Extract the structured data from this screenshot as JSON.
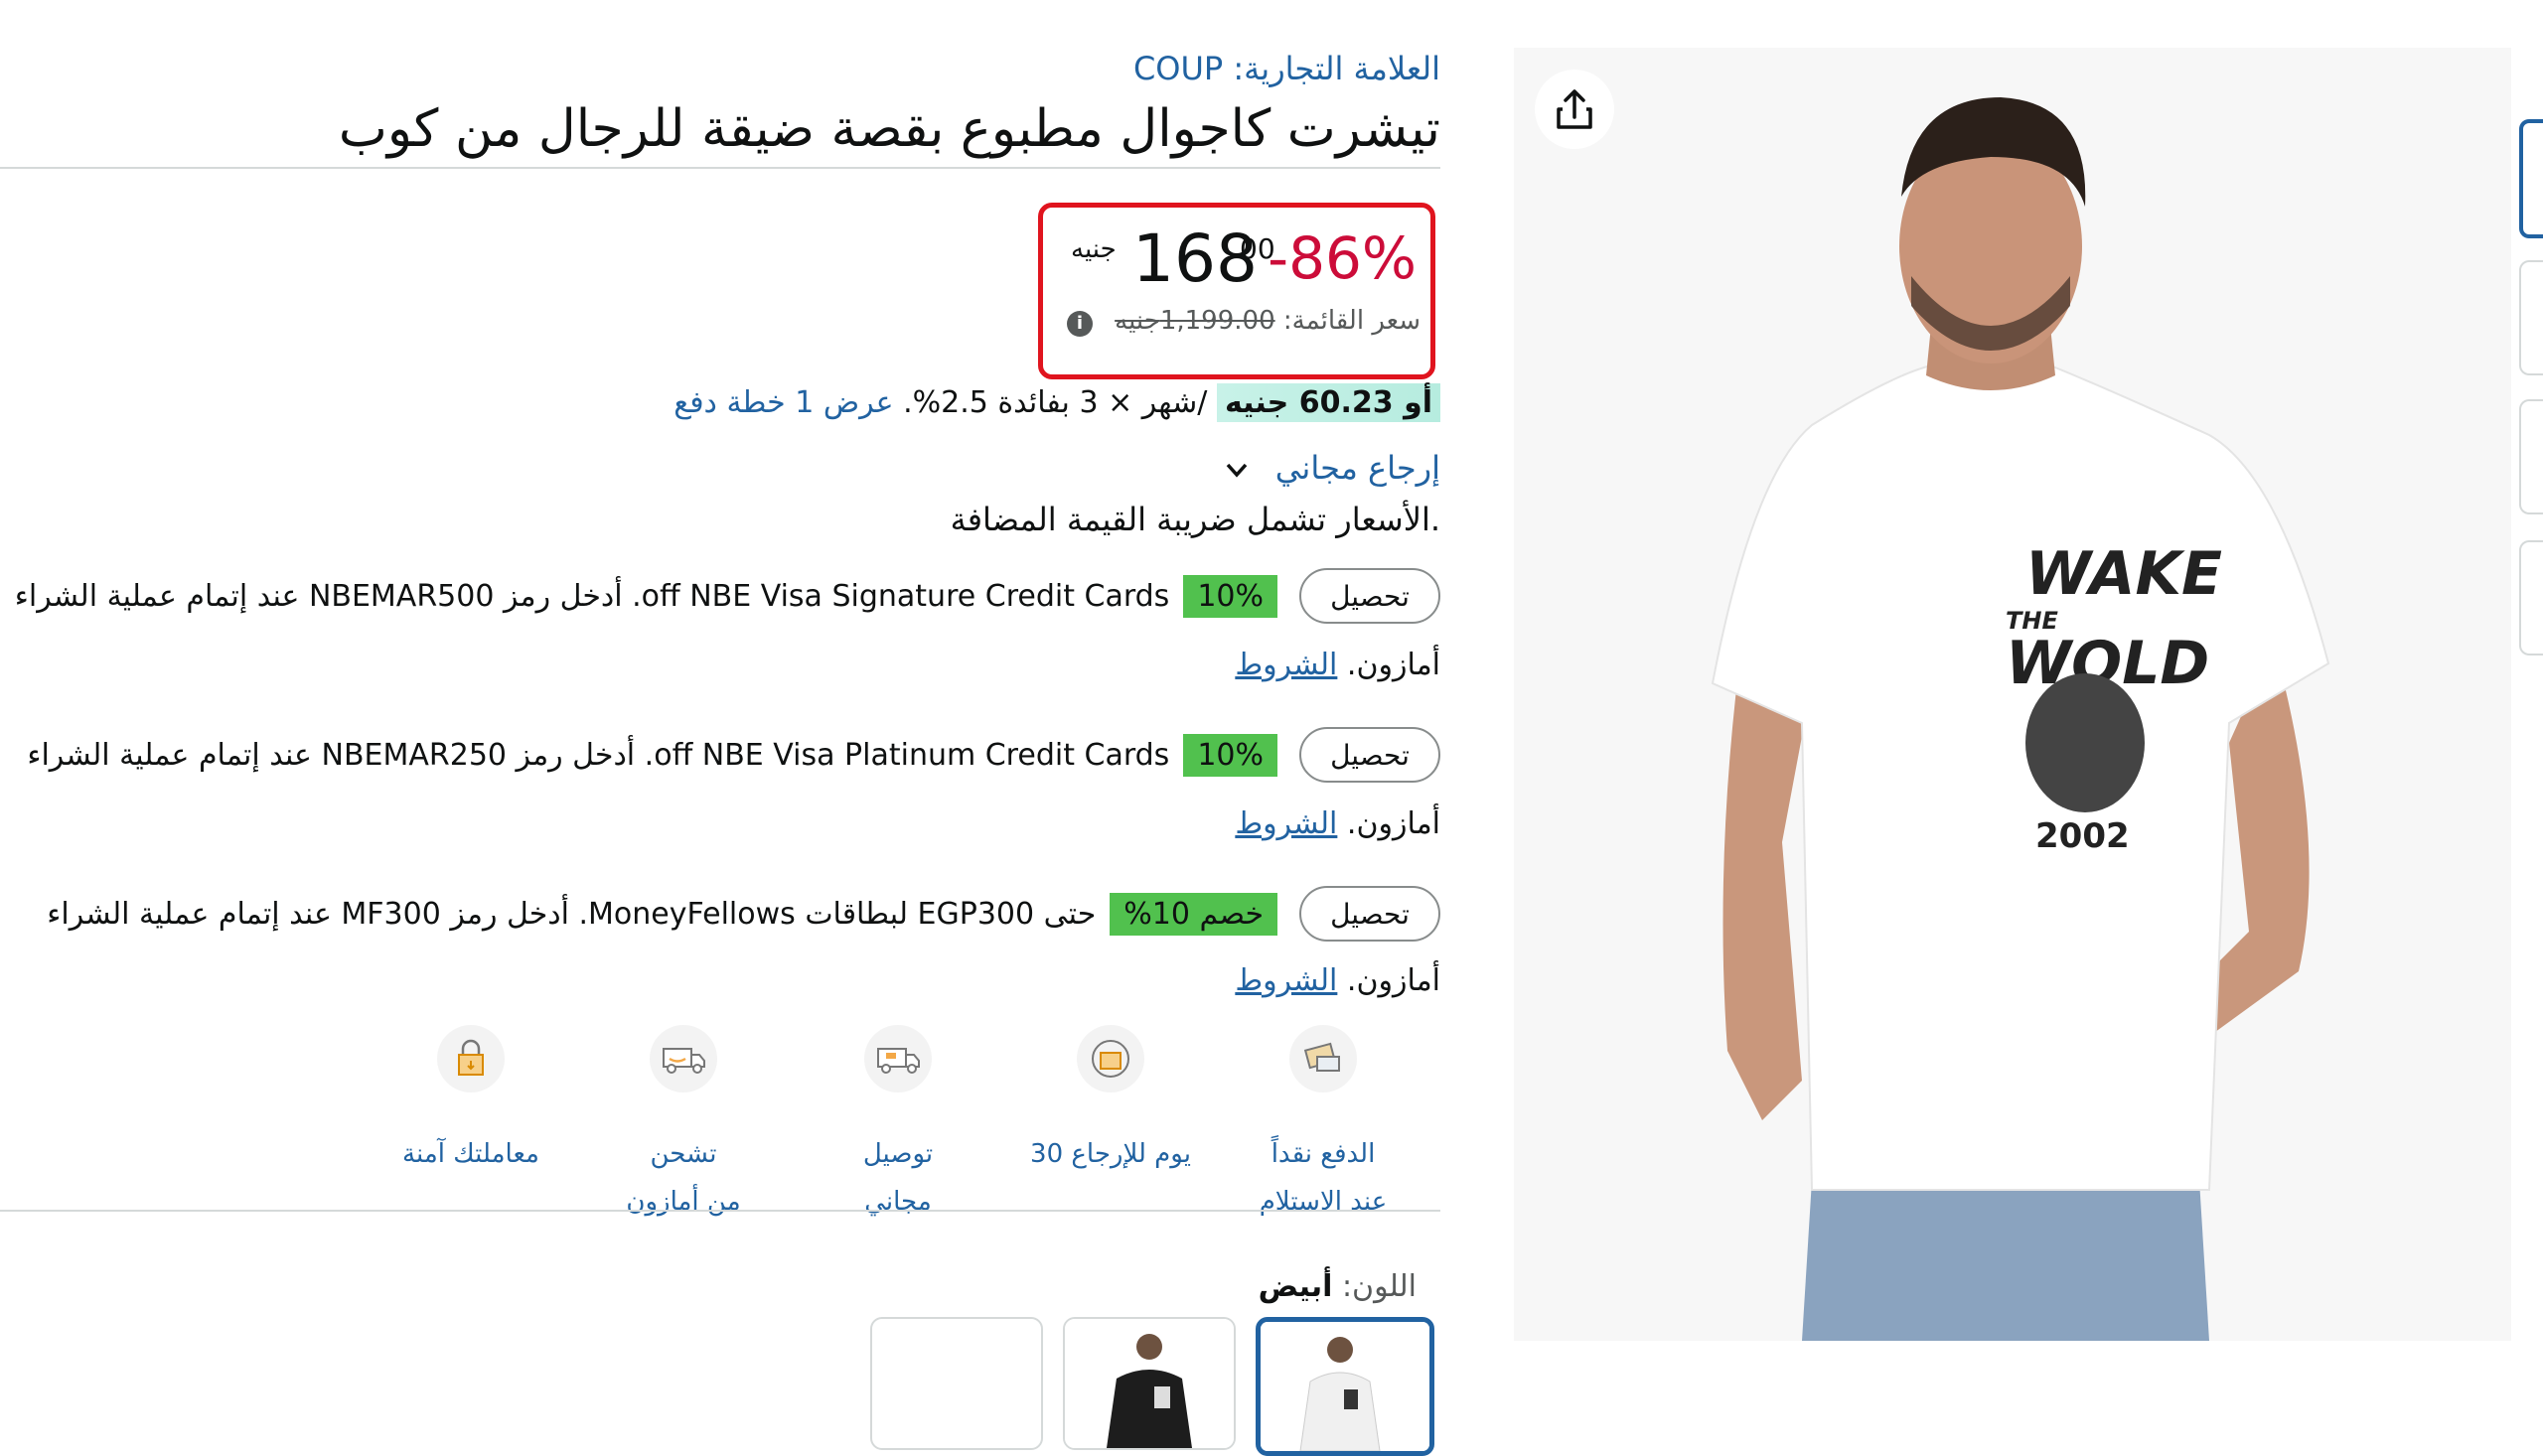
{
  "brand": {
    "label": "العلامة التجارية: COUP"
  },
  "title": "تيشرت كاجوال مطبوع بقصة ضيقة للرجال من كوب",
  "price": {
    "discount": "-86%",
    "currency": "جنيه",
    "whole": "168",
    "fraction": "00",
    "list_label": "سعر القائمة:",
    "list_value": "1,199.00جنيه"
  },
  "installment": {
    "prefix": "أو",
    "amount": "60.23 جنيه",
    "suffix": "/شهر × 3 بفائدة 2.5%.",
    "link": "عرض 1 خطة دفع"
  },
  "free_return": "إرجاع مجاني",
  "vat_note": ".الأسعار تشمل ضريبة القيمة المضافة",
  "offers": [
    {
      "button": "تحصيل",
      "badge": "10%",
      "text": "off NBE Visa Signature Credit Cards. أدخل رمز NBEMAR500 عند إتمام عملية الشراء",
      "terms_prefix": "أمازون.",
      "terms_link": "الشروط"
    },
    {
      "button": "تحصيل",
      "badge": "10%",
      "text": "off NBE Visa Platinum Credit Cards. أدخل رمز NBEMAR250 عند إتمام عملية الشراء",
      "terms_prefix": "أمازون.",
      "terms_link": "الشروط"
    },
    {
      "button": "تحصيل",
      "badge": "خصم 10%",
      "text": "حتى EGP300 لبطاقات MoneyFellows. أدخل رمز MF300 عند إتمام عملية الشراء",
      "terms_prefix": "أمازون.",
      "terms_link": "الشروط"
    }
  ],
  "features": [
    {
      "icon": "cash-on-delivery-icon",
      "line1": "الدفع نقداً",
      "line2": "عند الاستلام"
    },
    {
      "icon": "return-box-icon",
      "line1": "30 يوم للإرجاع",
      "line2": ""
    },
    {
      "icon": "free-delivery-truck-icon",
      "line1": "توصيل",
      "line2": "مجاني"
    },
    {
      "icon": "amazon-truck-icon",
      "line1": "تشحن",
      "line2": "من أمازون"
    },
    {
      "icon": "secure-lock-icon",
      "line1": "معاملتك آمنة",
      "line2": ""
    }
  ],
  "color": {
    "label": "اللون:",
    "value": "أبيض"
  },
  "colors": {
    "accent": "#2162a1",
    "discount": "#cc0c39",
    "badge_green": "#51c14e",
    "price_box_border": "#e0141e"
  },
  "product_image": {
    "shirt_text_1": "WAKE",
    "shirt_text_2": "THE",
    "shirt_text_3": "WOLD",
    "shirt_text_4": "2002"
  }
}
